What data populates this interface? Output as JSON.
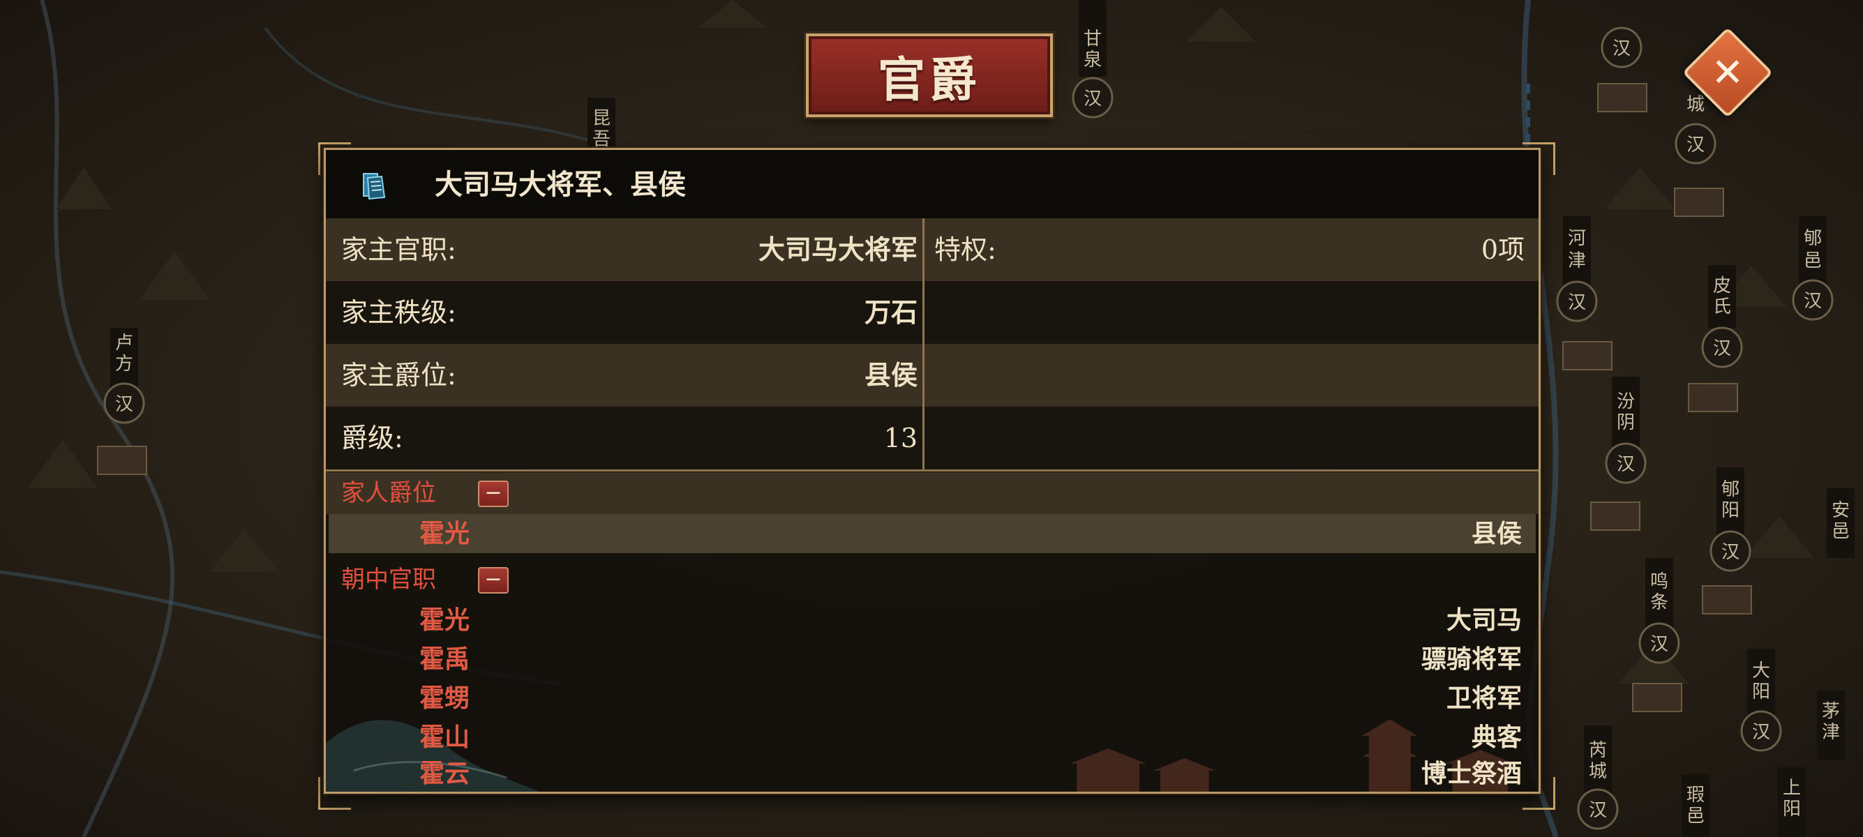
{
  "title": "官爵",
  "header": {
    "title": "大司马大将军、县侯",
    "icon": "book-icon"
  },
  "info_rows": [
    {
      "label": "家主官职:",
      "value": "大司马大将军",
      "right_label": "特权:",
      "right_value": "0项"
    },
    {
      "label": "家主秩级:",
      "value": "万石",
      "right_label": "",
      "right_value": ""
    },
    {
      "label": "家主爵位:",
      "value": "县侯",
      "right_label": "",
      "right_value": ""
    },
    {
      "label": "爵级:",
      "value": "13",
      "right_label": "",
      "right_value": ""
    }
  ],
  "family_titles": {
    "label": "家人爵位",
    "toggle": "−",
    "items": [
      {
        "name": "霍光",
        "value": "县侯"
      }
    ]
  },
  "court_posts": {
    "label": "朝中官职",
    "toggle": "−",
    "items": [
      {
        "name": "霍光",
        "value": "大司马"
      },
      {
        "name": "霍禹",
        "value": "骠骑将军"
      },
      {
        "name": "霍甥",
        "value": "卫将军"
      },
      {
        "name": "霍山",
        "value": "典客"
      },
      {
        "name": "霍云",
        "value": "博士祭酒"
      }
    ]
  },
  "close_icon": "close-icon",
  "map_labels": [
    "甘泉",
    "汉",
    "昆吾",
    "卢方",
    "河津",
    "皮氏",
    "郇邑",
    "汾阴",
    "郇阳",
    "安邑",
    "鸣条",
    "大阳",
    "茅津",
    "上阳",
    "芮城",
    "瑕邑",
    "城"
  ],
  "colors": {
    "accent_red": "#e2503d",
    "plaque_red": "#8a2a22",
    "gold": "#c9a36b",
    "text": "#efe2c5"
  }
}
